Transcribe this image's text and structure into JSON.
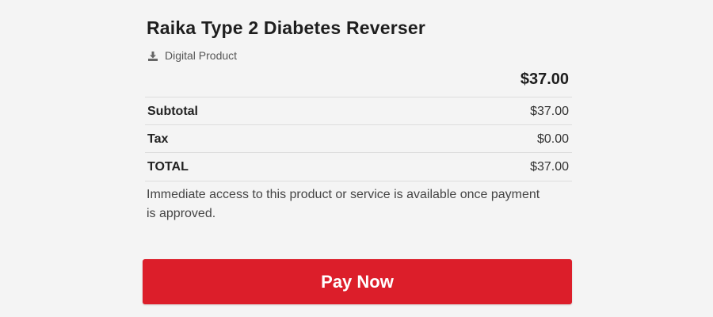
{
  "product": {
    "title": "Raika Type 2 Diabetes Reverser",
    "type_icon": "download-icon",
    "type_label": "Digital Product",
    "price": "$37.00"
  },
  "summary": [
    {
      "label": "Subtotal",
      "value": "$37.00"
    },
    {
      "label": "Tax",
      "value": "$0.00"
    },
    {
      "label": "TOTAL",
      "value": "$37.00"
    }
  ],
  "note": "Immediate access to this product or service is available once payment is approved.",
  "pay_button": {
    "label": "Pay Now",
    "color": "#dc1e2a"
  }
}
